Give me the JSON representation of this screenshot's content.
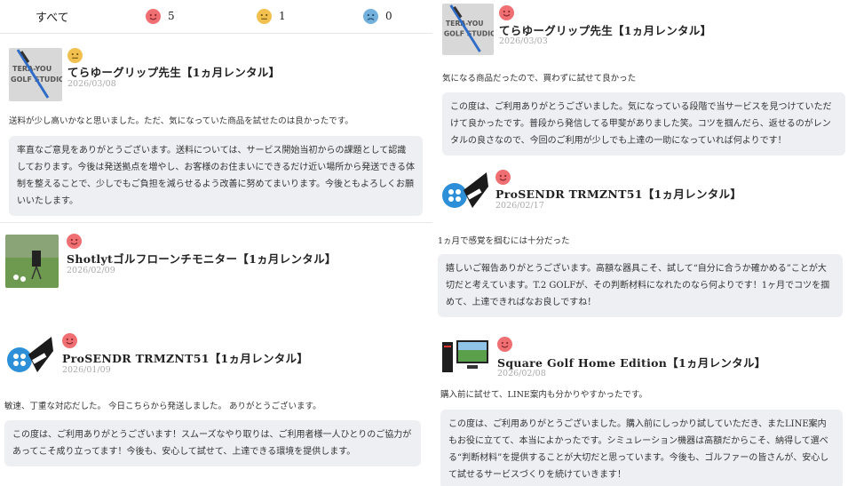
{
  "filter": {
    "all_label": "すべて",
    "good_count": "5",
    "neutral_count": "1",
    "bad_count": "0"
  },
  "colors": {
    "good": "#ef6f73",
    "neutral": "#f2c04f",
    "bad": "#74b0dc",
    "reply_bg": "#eeeff2"
  },
  "reviews": [
    {
      "rating": "neutral",
      "image": "grip-photo-thumbnail",
      "image_text": "TERA-YOU GOLF STUDIO",
      "title": "てらゆーグリップ先生【1ヵ月レンタル】",
      "date": "2026/03/08",
      "comment": "送料が少し高いかなと思いました。ただ、気になっていた商品を試せたのは良かったです。",
      "reply": "率直なご意見をありがとうございます。送料については、サービス開始当初からの課題として認識しております。今後は発送拠点を増やし、お客様のお住まいにできるだけ近い場所から発送できる体制を整えることで、少しでもご負担を減らせるよう改善に努めてまいります。今後ともよろしくお願いいたします。"
    },
    {
      "rating": "good",
      "image": "launch-monitor-photo-thumbnail",
      "title": "Shotlytゴルフローンチモニター【1ヵ月レンタル】",
      "date": "2026/02/09",
      "comment": "",
      "reply": ""
    },
    {
      "rating": "good",
      "image": "prosendr-product-thumbnail",
      "title": "ProSENDR TRMZNT51【1ヵ月レンタル】",
      "date": "2026/01/09",
      "comment": "敏速、丁重な対応だした。 今日こちらから発送しました。 ありがとうございます。",
      "reply": "この度は、ご利用ありがとうございます！スムーズなやり取りは、ご利用者様一人ひとりのご協力があってこそ成り立ってます！今後も、安心して試せて、上達できる環境を提供します。"
    },
    {
      "rating": "good",
      "image": "grip-photo-thumbnail",
      "image_text": "TERA-YOU GOLF STUDIO",
      "title": "てらゆーグリップ先生【1ヵ月レンタル】",
      "date": "2026/03/03",
      "comment": "気になる商品だったので、買わずに試せて良かった",
      "reply": "この度は、ご利用ありがとうございました。気になっている段階で当サービスを見つけていただけて良かったです。普段から発信してる甲斐がありました笑。コツを掴んだら、返せるのがレンタルの良さなので、今回のご利用が少しでも上達の一助になっていれば何よりです！"
    },
    {
      "rating": "good",
      "image": "prosendr-product-thumbnail",
      "title": "ProSENDR TRMZNT51【1ヵ月レンタル】",
      "date": "2026/02/17",
      "comment": "1ヵ月で感覚を掴むには十分だった",
      "reply": "嬉しいご報告ありがとうございます。高額な器具こそ、試して“自分に合うか確かめる”ことが大切だと考えています。T.2 GOLFが、その判断材料になれたのなら何よりです！1ヶ月でコツを掴めて、上達できればなお良しですね！"
    },
    {
      "rating": "good",
      "image": "square-golf-product-thumbnail",
      "title": "Square Golf Home Edition【1ヵ月レンタル】",
      "date": "2026/02/08",
      "comment": "購入前に試せて、LINE案内も分かりやすかったです。",
      "reply": "この度は、ご利用ありがとうございました。購入前にしっかり試していただき、またLINE案内もお役に立てて、本当によかったです。シミュレーション機器は高額だからこそ、納得して選べる“判断材料”を提供することが大切だと思っています。今後も、ゴルファーの皆さんが、安心して試せるサービスづくりを続けていきます！"
    }
  ]
}
